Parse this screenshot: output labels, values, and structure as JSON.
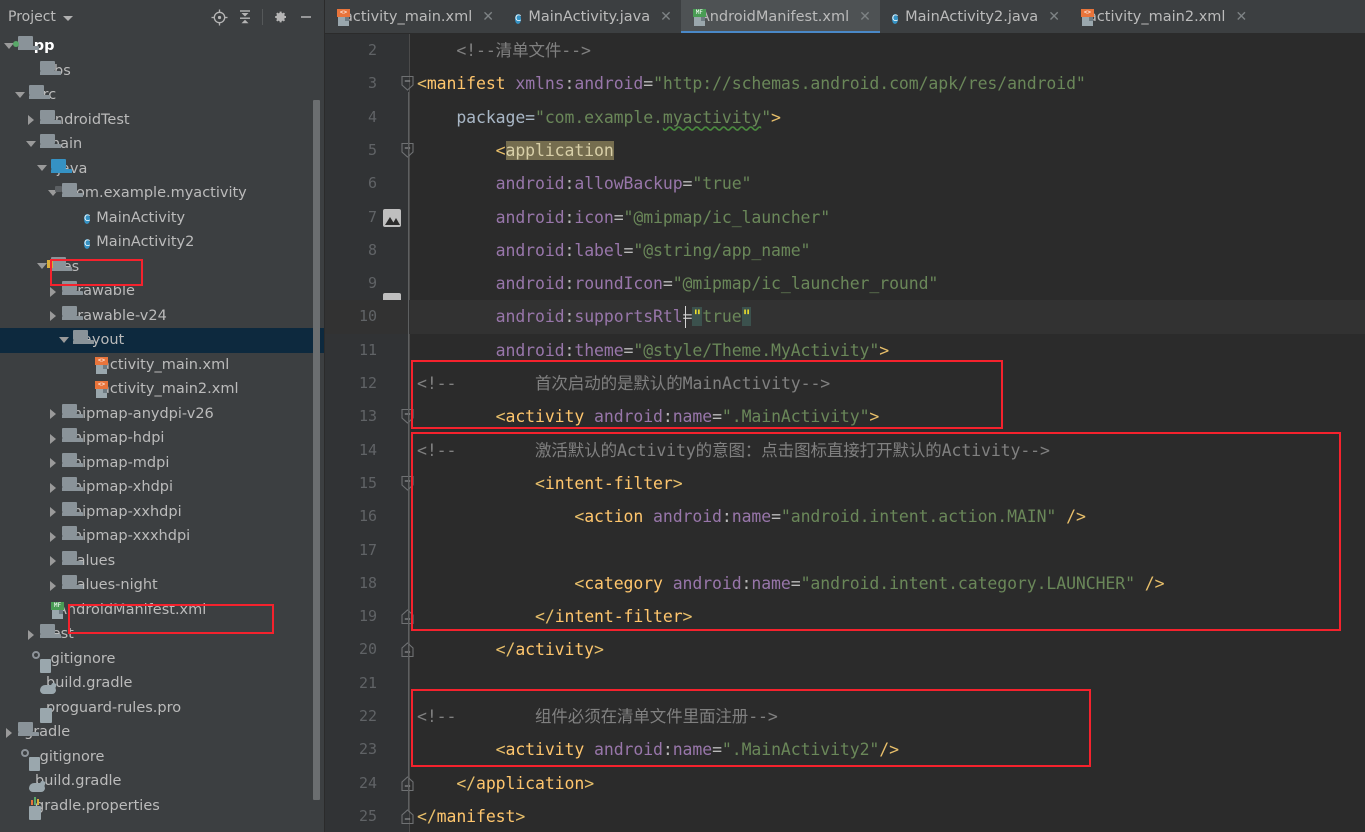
{
  "project_panel": {
    "title": "Project",
    "toolbar_icons": [
      "locate-target-icon",
      "collapse-all-icon",
      "settings-gear-icon",
      "hide-panel-icon"
    ],
    "tree": [
      {
        "label": "app",
        "depth": 0,
        "arrow": "open",
        "icon": "folder-module",
        "bold": true,
        "selected": false
      },
      {
        "label": "libs",
        "depth": 2,
        "arrow": "none",
        "icon": "folder",
        "bold": false,
        "selected": false
      },
      {
        "label": "src",
        "depth": 1,
        "arrow": "open",
        "icon": "folder",
        "bold": false,
        "selected": false
      },
      {
        "label": "androidTest",
        "depth": 2,
        "arrow": "closed",
        "icon": "folder",
        "bold": false,
        "selected": false
      },
      {
        "label": "main",
        "depth": 2,
        "arrow": "open",
        "icon": "folder",
        "bold": false,
        "selected": false
      },
      {
        "label": "java",
        "depth": 3,
        "arrow": "open",
        "icon": "folder-blue",
        "bold": false,
        "selected": false
      },
      {
        "label": "com.example.myactivity",
        "depth": 4,
        "arrow": "open",
        "icon": "folder-package",
        "bold": false,
        "selected": false
      },
      {
        "label": "MainActivity",
        "depth": 6,
        "arrow": "none",
        "icon": "class",
        "bold": false,
        "selected": false
      },
      {
        "label": "MainActivity2",
        "depth": 6,
        "arrow": "none",
        "icon": "class",
        "bold": false,
        "selected": false
      },
      {
        "label": "res",
        "depth": 3,
        "arrow": "open",
        "icon": "folder-res",
        "bold": false,
        "selected": false
      },
      {
        "label": "drawable",
        "depth": 4,
        "arrow": "closed",
        "icon": "folder",
        "bold": false,
        "selected": false
      },
      {
        "label": "drawable-v24",
        "depth": 4,
        "arrow": "closed",
        "icon": "folder",
        "bold": false,
        "selected": false
      },
      {
        "label": "layout",
        "depth": 5,
        "arrow": "open",
        "icon": "folder",
        "bold": false,
        "selected": true
      },
      {
        "label": "activity_main.xml",
        "depth": 7,
        "arrow": "none",
        "icon": "xml-layout",
        "bold": false,
        "selected": false
      },
      {
        "label": "activity_main2.xml",
        "depth": 7,
        "arrow": "none",
        "icon": "xml-layout",
        "bold": false,
        "selected": false
      },
      {
        "label": "mipmap-anydpi-v26",
        "depth": 4,
        "arrow": "closed",
        "icon": "folder",
        "bold": false,
        "selected": false
      },
      {
        "label": "mipmap-hdpi",
        "depth": 4,
        "arrow": "closed",
        "icon": "folder",
        "bold": false,
        "selected": false
      },
      {
        "label": "mipmap-mdpi",
        "depth": 4,
        "arrow": "closed",
        "icon": "folder",
        "bold": false,
        "selected": false
      },
      {
        "label": "mipmap-xhdpi",
        "depth": 4,
        "arrow": "closed",
        "icon": "folder",
        "bold": false,
        "selected": false
      },
      {
        "label": "mipmap-xxhdpi",
        "depth": 4,
        "arrow": "closed",
        "icon": "folder",
        "bold": false,
        "selected": false
      },
      {
        "label": "mipmap-xxxhdpi",
        "depth": 4,
        "arrow": "closed",
        "icon": "folder",
        "bold": false,
        "selected": false
      },
      {
        "label": "values",
        "depth": 4,
        "arrow": "closed",
        "icon": "folder",
        "bold": false,
        "selected": false
      },
      {
        "label": "values-night",
        "depth": 4,
        "arrow": "closed",
        "icon": "folder",
        "bold": false,
        "selected": false
      },
      {
        "label": "AndroidManifest.xml",
        "depth": 3,
        "arrow": "none",
        "icon": "xml-manifest",
        "bold": false,
        "selected": false
      },
      {
        "label": "test",
        "depth": 2,
        "arrow": "closed",
        "icon": "folder",
        "bold": false,
        "selected": false
      },
      {
        "label": ".gitignore",
        "depth": 2,
        "arrow": "none",
        "icon": "gitignore",
        "bold": false,
        "selected": false
      },
      {
        "label": "build.gradle",
        "depth": 2,
        "arrow": "none",
        "icon": "gradle",
        "bold": false,
        "selected": false
      },
      {
        "label": "proguard-rules.pro",
        "depth": 2,
        "arrow": "none",
        "icon": "file",
        "bold": false,
        "selected": false
      },
      {
        "label": "gradle",
        "depth": 0,
        "arrow": "closed",
        "icon": "folder",
        "bold": false,
        "selected": false
      },
      {
        "label": ".gitignore",
        "depth": 1,
        "arrow": "none",
        "icon": "gitignore",
        "bold": false,
        "selected": false
      },
      {
        "label": "build.gradle",
        "depth": 1,
        "arrow": "none",
        "icon": "gradle",
        "bold": false,
        "selected": false
      },
      {
        "label": "gradle.properties",
        "depth": 1,
        "arrow": "none",
        "icon": "properties",
        "bold": false,
        "selected": false
      }
    ]
  },
  "tabs": [
    {
      "label": "activity_main.xml",
      "icon": "xml-layout-icon",
      "active": false,
      "closable": true
    },
    {
      "label": "MainActivity.java",
      "icon": "java-class-icon",
      "active": false,
      "closable": true
    },
    {
      "label": "AndroidManifest.xml",
      "icon": "xml-manifest-icon",
      "active": true,
      "closable": true
    },
    {
      "label": "MainActivity2.java",
      "icon": "java-class-icon",
      "active": false,
      "closable": true
    },
    {
      "label": "activity_main2.xml",
      "icon": "xml-layout-icon",
      "active": false,
      "closable": true
    }
  ],
  "editor": {
    "active_file": "AndroidManifest.xml",
    "caret_line": 10,
    "first_visible_line": 2,
    "last_visible_line": 25,
    "lines": [
      {
        "n": 2,
        "text": "    <!--清单文件-->"
      },
      {
        "n": 3,
        "text": "<manifest xmlns:android=\"http://schemas.android.com/apk/res/android\""
      },
      {
        "n": 4,
        "text": "    package=\"com.example.myactivity\">"
      },
      {
        "n": 5,
        "text": "    <application"
      },
      {
        "n": 6,
        "text": "        android:allowBackup=\"true\""
      },
      {
        "n": 7,
        "text": "        android:icon=\"@mipmap/ic_launcher\""
      },
      {
        "n": 8,
        "text": "        android:label=\"@string/app_name\""
      },
      {
        "n": 9,
        "text": "        android:roundIcon=\"@mipmap/ic_launcher_round\""
      },
      {
        "n": 10,
        "text": "        android:supportsRtl=\"true\""
      },
      {
        "n": 11,
        "text": "        android:theme=\"@style/Theme.MyActivity\">"
      },
      {
        "n": 12,
        "text": "<!--        首次启动的是默认的MainActivity-->"
      },
      {
        "n": 13,
        "text": "        <activity android:name=\".MainActivity\">"
      },
      {
        "n": 14,
        "text": "<!--        激活默认的Activity的意图：点击图标直接打开默认的Activity-->"
      },
      {
        "n": 15,
        "text": "            <intent-filter>"
      },
      {
        "n": 16,
        "text": "                <action android:name=\"android.intent.action.MAIN\" />"
      },
      {
        "n": 17,
        "text": ""
      },
      {
        "n": 18,
        "text": "                <category android:name=\"android.intent.category.LAUNCHER\" />"
      },
      {
        "n": 19,
        "text": "            </intent-filter>"
      },
      {
        "n": 20,
        "text": "        </activity>"
      },
      {
        "n": 21,
        "text": ""
      },
      {
        "n": 22,
        "text": "<!--        组件必须在清单文件里面注册-->"
      },
      {
        "n": 23,
        "text": "        <activity android:name=\".MainActivity2\"/>"
      },
      {
        "n": 24,
        "text": "    </application>"
      },
      {
        "n": 25,
        "text": "</manifest>"
      }
    ],
    "gutter_image_icon_lines": [
      7,
      9
    ],
    "fold_open_lines": [
      3,
      5,
      13,
      15
    ],
    "fold_close_lines": [
      19,
      20,
      24,
      25
    ]
  },
  "annotations": [
    {
      "name": "res-folder-highlight",
      "target": "res"
    },
    {
      "name": "manifest-file-highlight",
      "target": "AndroidManifest.xml"
    },
    {
      "name": "default-activity-highlight",
      "target": "lines 12-13"
    },
    {
      "name": "intent-filter-highlight",
      "target": "lines 14-19"
    },
    {
      "name": "second-activity-highlight",
      "target": "lines 22-23"
    }
  ],
  "colors": {
    "panel_bg": "#3c3f41",
    "editor_bg": "#2b2b2b",
    "gutter_bg": "#313335",
    "caret_line_bg": "#323232",
    "selection_bg": "#0d293e",
    "tab_active_bg": "#4e5254",
    "tab_active_underline": "#4a88c7",
    "annotation_red": "#f5222d",
    "comment": "#808080",
    "tag": "#e8bf6a",
    "namespace": "#9876aa",
    "string": "#6a8759",
    "text": "#a9b7c6"
  }
}
